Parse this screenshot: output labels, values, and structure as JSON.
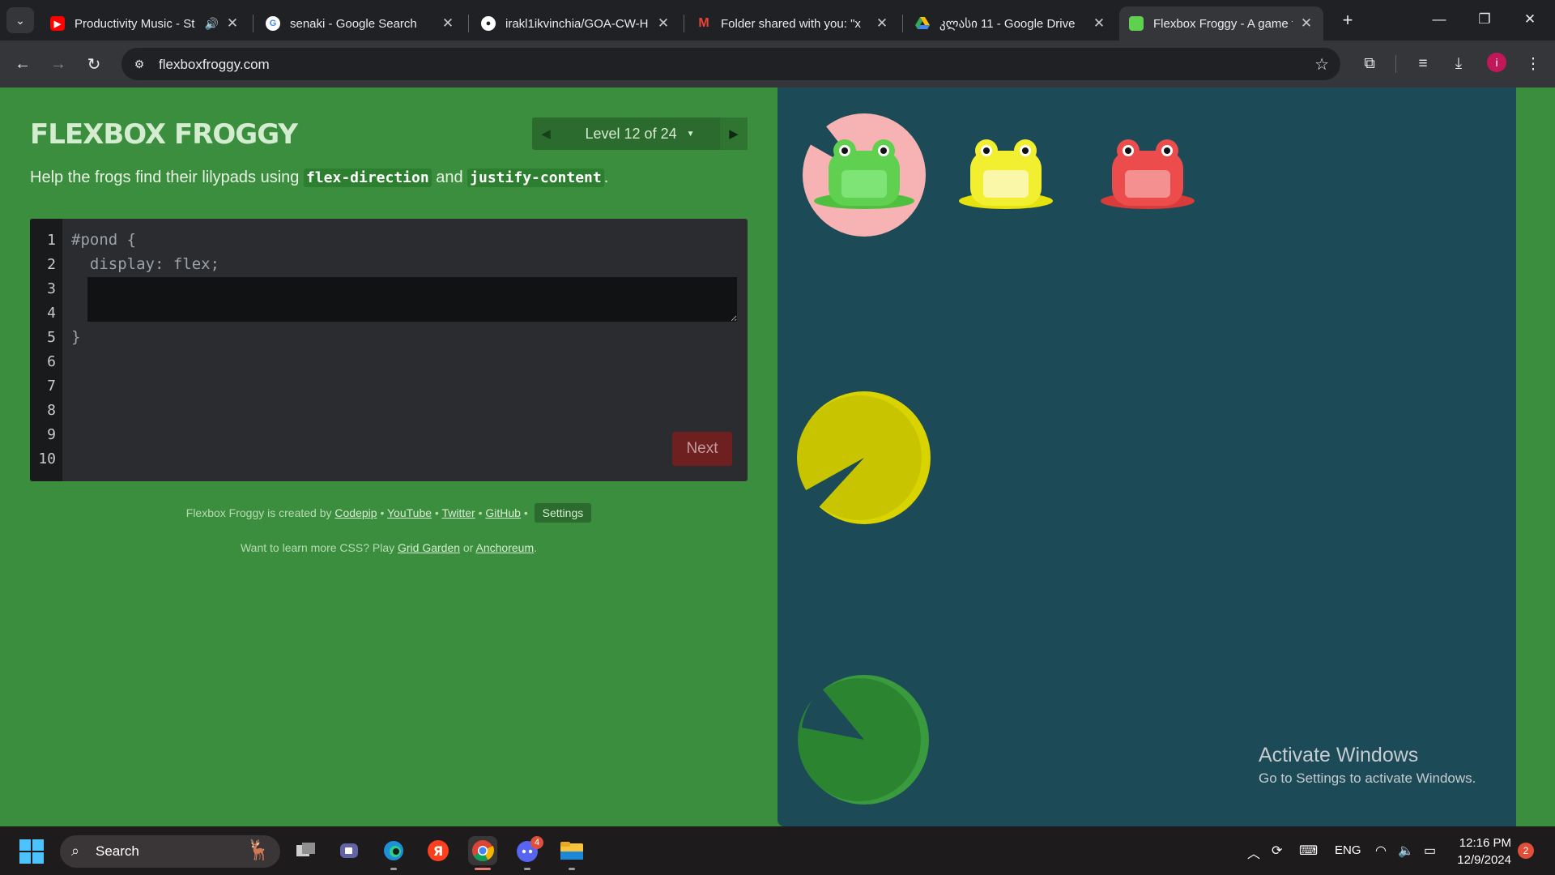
{
  "browser": {
    "tabs": [
      {
        "title": "Productivity Music - St",
        "favicon": "youtube-icon",
        "audio": true,
        "active": false
      },
      {
        "title": "senaki - Google Search",
        "favicon": "google-icon",
        "active": false
      },
      {
        "title": "irakl1ikvinchia/GOA-CW-H",
        "favicon": "github-icon",
        "active": false
      },
      {
        "title": "Folder shared with you: \"x",
        "favicon": "gmail-icon",
        "active": false
      },
      {
        "title": "კლასი 11 - Google Drive",
        "favicon": "drive-icon",
        "active": false
      },
      {
        "title": "Flexbox Froggy - A game f",
        "favicon": "frog-icon",
        "active": true
      }
    ],
    "url": "flexboxfroggy.com",
    "profile_initial": "i"
  },
  "game": {
    "logo": "FLEXBOX FROGGY",
    "level_label": "Level 12 of 24",
    "instructions": {
      "before": "Help the frogs find their lilypads using ",
      "prop1": "flex-direction",
      "middle": " and ",
      "prop2": "justify-content",
      "after": "."
    },
    "editor": {
      "line_numbers": [
        "1",
        "2",
        "3",
        "4",
        "5",
        "6",
        "7",
        "8",
        "9",
        "10"
      ],
      "line1": "#pond {",
      "line2": "  display: flex;",
      "line5": "}",
      "input_value": "",
      "next_label": "Next"
    },
    "credits": {
      "prefix": "Flexbox Froggy is created by ",
      "author": "Codepip",
      "sep": " • ",
      "youtube": "YouTube",
      "twitter": "Twitter",
      "github": "GitHub",
      "settings": "Settings"
    },
    "learn": {
      "prefix": "Want to learn more CSS? Play ",
      "grid": "Grid Garden",
      "or": " or ",
      "anchor": "Anchoreum",
      "suffix": "."
    },
    "frogs": [
      "green",
      "yellow",
      "red"
    ],
    "lilypads": [
      "green",
      "yellow",
      "red"
    ],
    "colors": {
      "green": "#5fd04f",
      "yellow": "#f2ef31",
      "red": "#ec4c4c",
      "pond": "#1c4a56",
      "page": "#3a8e3d"
    }
  },
  "watermark": {
    "title": "Activate Windows",
    "subtitle": "Go to Settings to activate Windows."
  },
  "taskbar": {
    "search_label": "Search",
    "discord_badge": "4",
    "language": "ENG",
    "time": "12:16 PM",
    "date": "12/9/2024",
    "notifications": "2"
  }
}
